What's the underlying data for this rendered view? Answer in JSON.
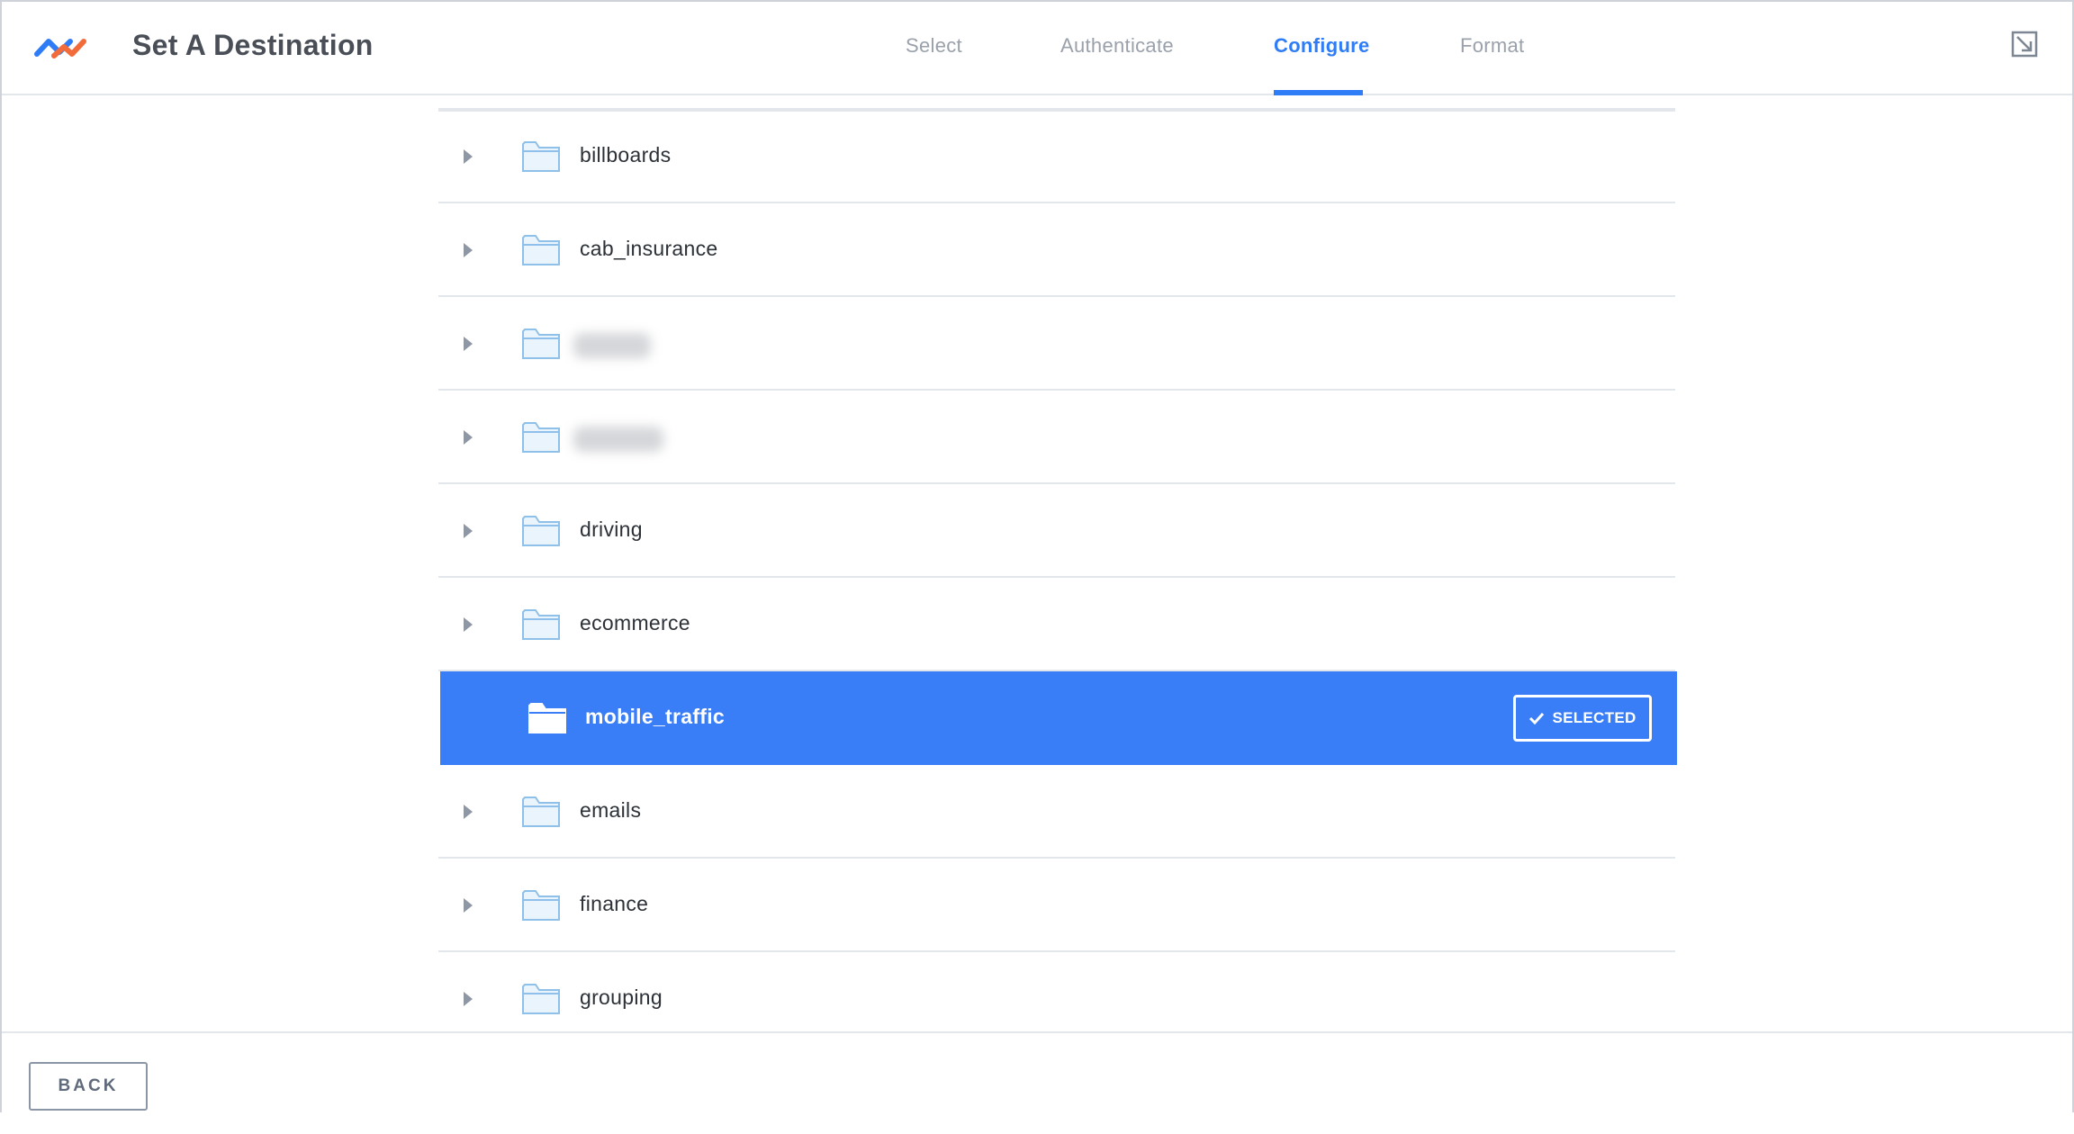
{
  "header": {
    "title": "Set A Destination",
    "tabs": [
      {
        "label": "Select",
        "active": false
      },
      {
        "label": "Authenticate",
        "active": false
      },
      {
        "label": "Configure",
        "active": true
      },
      {
        "label": "Format",
        "active": false
      }
    ]
  },
  "list": {
    "items": [
      {
        "label": "billboards",
        "selected": false,
        "redacted": false
      },
      {
        "label": "cab_insurance",
        "selected": false,
        "redacted": false
      },
      {
        "label": "",
        "selected": false,
        "redacted": true
      },
      {
        "label": "",
        "selected": false,
        "redacted": true
      },
      {
        "label": "driving",
        "selected": false,
        "redacted": false
      },
      {
        "label": "ecommerce",
        "selected": false,
        "redacted": false
      },
      {
        "label": "mobile_traffic",
        "selected": true,
        "redacted": false,
        "badge": "SELECTED"
      },
      {
        "label": "emails",
        "selected": false,
        "redacted": false
      },
      {
        "label": "finance",
        "selected": false,
        "redacted": false
      },
      {
        "label": "grouping",
        "selected": false,
        "redacted": false
      }
    ]
  },
  "footer": {
    "back_label": "BACK"
  },
  "colors": {
    "accent": "#2f7df6",
    "selected_row": "#3a7ef7",
    "folder_stroke": "#8fc0ea",
    "folder_fill": "#eaf4fd"
  },
  "icons": {
    "logo": "brand-wave-logo",
    "expand": "expand-window-icon",
    "folder": "folder-icon",
    "chevron": "chevron-right-icon",
    "check": "check-icon"
  }
}
